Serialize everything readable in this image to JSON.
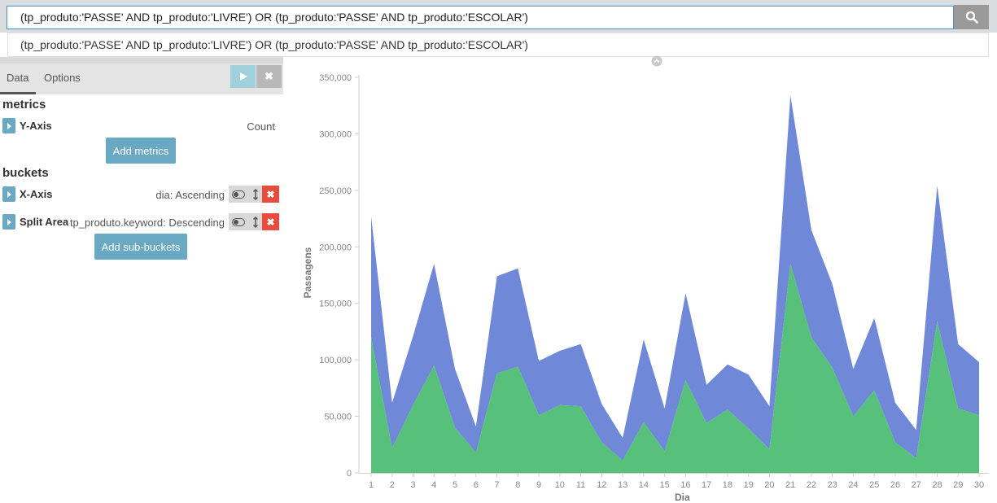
{
  "query": {
    "value": "(tp_produto:'PASSE'  AND tp_produto:'LIVRE') OR (tp_produto:'PASSE' AND tp_produto:'ESCOLAR')",
    "suggestion": "(tp_produto:'PASSE' AND tp_produto:'LIVRE') OR (tp_produto:'PASSE' AND tp_produto:'ESCOLAR')",
    "search_icon": "search-icon"
  },
  "sidebar": {
    "tabs": [
      {
        "label": "Data"
      },
      {
        "label": "Options"
      }
    ],
    "apply_icon": "play-icon",
    "discard_icon": "close-icon",
    "metrics_title": "metrics",
    "metrics": [
      {
        "label": "Y-Axis",
        "desc": "Count"
      }
    ],
    "add_metrics": "Add metrics",
    "buckets_title": "buckets",
    "buckets": [
      {
        "label": "X-Axis",
        "desc": "dia: Ascending"
      },
      {
        "label": "Split Area",
        "desc": "tp_produto.keyword: Descending"
      }
    ],
    "add_buckets": "Add sub-buckets"
  },
  "colors": {
    "series_escolar": "#7088d8",
    "series_livre": "#57c17b",
    "accent": "#6aa9c3",
    "danger": "#e74c3c"
  },
  "chart_data": {
    "type": "area",
    "stacked": true,
    "xlabel": "Dia",
    "ylabel": "Passagens",
    "ylim": [
      0,
      350000
    ],
    "yticks": [
      "0",
      "50,000",
      "100,000",
      "150,000",
      "200,000",
      "250,000",
      "300,000",
      "350,000"
    ],
    "x": [
      1,
      2,
      3,
      4,
      5,
      6,
      7,
      8,
      9,
      10,
      11,
      12,
      13,
      14,
      15,
      16,
      17,
      18,
      19,
      20,
      21,
      22,
      23,
      24,
      25,
      26,
      27,
      28,
      29,
      30
    ],
    "series": [
      {
        "values": [
          120000,
          22000,
          60000,
          95000,
          40000,
          18000,
          88000,
          94000,
          51000,
          60000,
          59000,
          27000,
          11000,
          45000,
          19000,
          82000,
          44000,
          56000,
          39000,
          21000,
          185000,
          120000,
          93000,
          50000,
          73000,
          27000,
          13000,
          134000,
          57000,
          51000
        ]
      },
      {
        "values": [
          107000,
          40000,
          61000,
          90000,
          52000,
          23000,
          86000,
          87000,
          48000,
          48000,
          55000,
          34000,
          20000,
          73000,
          38000,
          77000,
          34000,
          40000,
          48000,
          38000,
          149000,
          95000,
          74000,
          42000,
          64000,
          35000,
          25000,
          120000,
          57000,
          47000
        ]
      }
    ]
  }
}
